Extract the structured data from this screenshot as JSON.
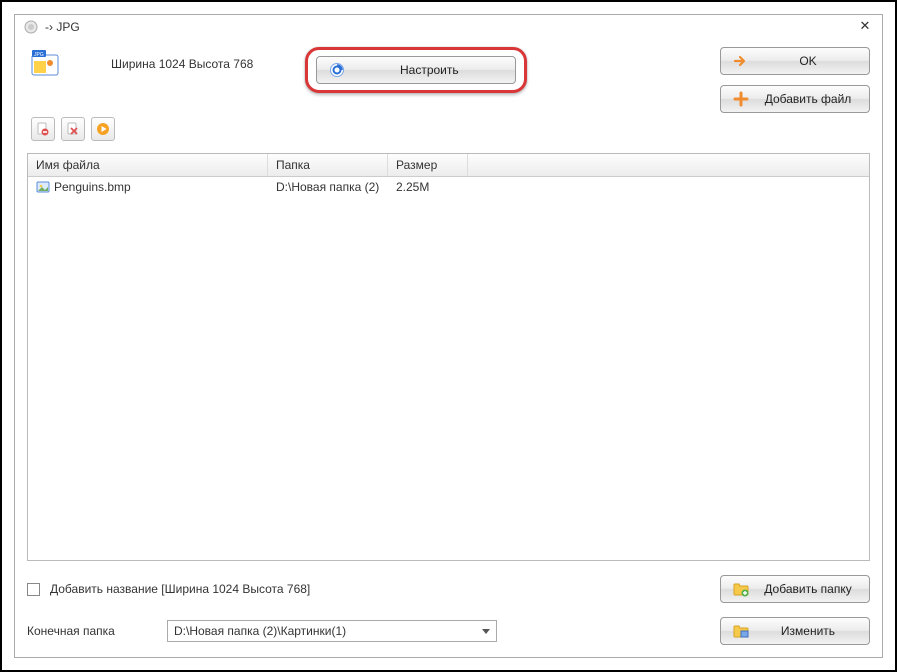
{
  "window": {
    "title": "-› JPG"
  },
  "top": {
    "dimensions": "Ширина 1024 Высота 768",
    "settings_label": "Настроить",
    "ok_label": "OK",
    "add_file_label": "Добавить файл"
  },
  "columns": {
    "name": "Имя файла",
    "folder": "Папка",
    "size": "Размер"
  },
  "files": [
    {
      "name": "Penguins.bmp",
      "folder": "D:\\Новая папка (2)",
      "size": "2.25M"
    }
  ],
  "bottom": {
    "add_title_checkbox": "Добавить название [Ширина 1024 Высота 768]",
    "add_folder_label": "Добавить папку",
    "dest_label": "Конечная папка",
    "dest_value": "D:\\Новая папка (2)\\Картинки(1)",
    "change_label": "Изменить"
  }
}
